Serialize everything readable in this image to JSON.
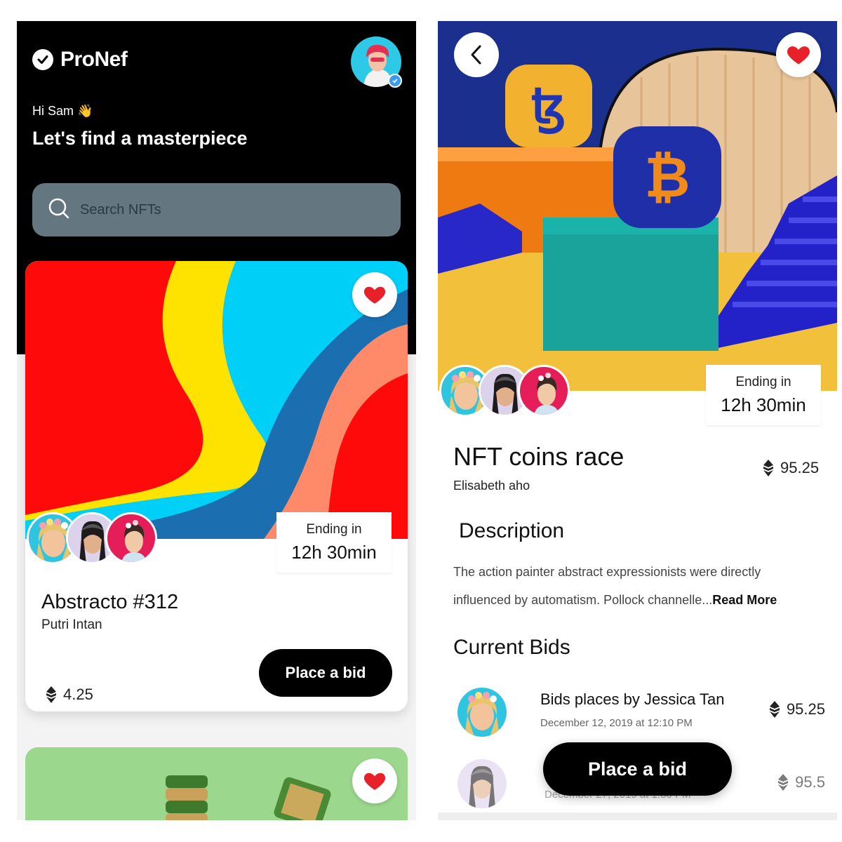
{
  "left": {
    "brand": "ProNef",
    "greeting": "Hi Sam 👋",
    "tagline": "Let's find a masterpiece",
    "search": {
      "placeholder": "Search NFTs"
    },
    "card": {
      "title": "Abstracto #312",
      "artist": "Putri Intan",
      "price": "4.25",
      "ending_label": "Ending in",
      "ending_value": "12h 30min",
      "bid_label": "Place a bid"
    }
  },
  "right": {
    "title": "NFT coins race",
    "artist": "Elisabeth aho",
    "price": "95.25",
    "ending_label": "Ending in",
    "ending_value": "12h 30min",
    "description_heading": "Description",
    "description_text": "The action painter abstract expressionists were directly influenced by automatism. Pollock channelle...",
    "read_more": "Read More",
    "bids_heading": "Current Bids",
    "bids": [
      {
        "name": "Bids places by Jessica Tan",
        "date": "December 12, 2019 at 12:10 PM",
        "price": "95.25"
      },
      {
        "name": "",
        "date": "December 27, 2019 at 1:30 PM",
        "price": "95.5"
      }
    ],
    "bid_label": "Place a bid"
  },
  "colors": {
    "accent_heart": "#e8202a",
    "button_black": "#000000",
    "search_bg": "#647680"
  },
  "icons": [
    "check-circle-icon",
    "search-icon",
    "heart-icon",
    "chevron-left-icon",
    "ethereum-icon",
    "verified-badge-icon"
  ]
}
